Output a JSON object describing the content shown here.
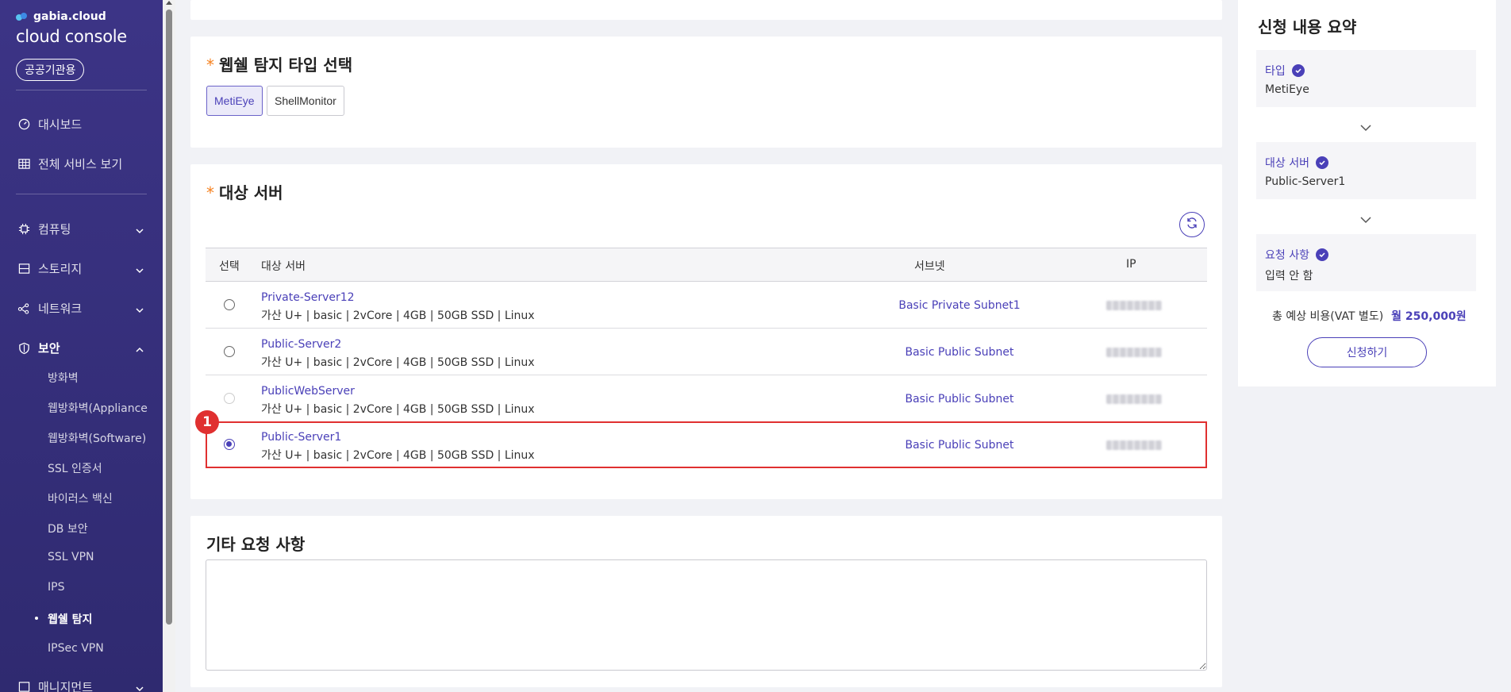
{
  "sidebar": {
    "brand": "gabia.cloud",
    "title": "cloud console",
    "badge": "공공기관용",
    "top_items": [
      {
        "label": "대시보드",
        "icon": "dashboard-icon"
      },
      {
        "label": "전체 서비스 보기",
        "icon": "grid-icon"
      }
    ],
    "menus": [
      {
        "label": "컴퓨팅",
        "icon": "cpu-icon"
      },
      {
        "label": "스토리지",
        "icon": "storage-icon"
      },
      {
        "label": "네트워크",
        "icon": "network-icon"
      },
      {
        "label": "보안",
        "icon": "shield-icon"
      }
    ],
    "security_sub": [
      "방화벽",
      "웹방화벽(Appliance",
      "웹방화벽(Software)",
      "SSL 인증서",
      "바이러스 백신",
      "DB 보안",
      "SSL VPN",
      "IPS",
      "웹쉘 탐지",
      "IPSec VPN"
    ],
    "last_menu": "매니지먼트"
  },
  "type_section": {
    "title": "웹쉘 탐지 타입 선택",
    "required_mark": "*",
    "options": [
      "MetiEye",
      "ShellMonitor"
    ],
    "selected": "MetiEye"
  },
  "server_section": {
    "title": "대상 서버",
    "required_mark": "*",
    "columns": {
      "select": "선택",
      "server": "대상 서버",
      "subnet": "서브넷",
      "ip": "IP"
    },
    "rows": [
      {
        "name": "Private-Server12",
        "spec": "가산 U+ | basic | 2vCore | 4GB | 50GB SSD | Linux",
        "subnet": "Basic Private Subnet1",
        "state": "unchecked"
      },
      {
        "name": "Public-Server2",
        "spec": "가산 U+ | basic | 2vCore | 4GB | 50GB SSD | Linux",
        "subnet": "Basic Public Subnet",
        "state": "unchecked"
      },
      {
        "name": "PublicWebServer",
        "spec": "가산 U+ | basic | 2vCore | 4GB | 50GB SSD | Linux",
        "subnet": "Basic Public Subnet",
        "state": "disabled"
      },
      {
        "name": "Public-Server1",
        "spec": "가산 U+ | basic | 2vCore | 4GB | 50GB SSD | Linux",
        "subnet": "Basic Public Subnet",
        "state": "checked"
      }
    ],
    "step_marker": "1"
  },
  "request_section": {
    "title": "기타 요청 사항",
    "value": ""
  },
  "summary": {
    "title": "신청 내용 요약",
    "items": [
      {
        "label": "타입",
        "value": "MetiEye"
      },
      {
        "label": "대상 서버",
        "value": "Public-Server1"
      },
      {
        "label": "요청 사항",
        "value": "입력 안 함"
      }
    ],
    "cost_label": "총 예상 비용(VAT 별도)",
    "cost_value": "월 250,000원",
    "apply_label": "신청하기"
  },
  "colors": {
    "brand": "#4a40b8",
    "sidebar": "#3c3486",
    "required": "#f58220",
    "highlight": "#e03030"
  }
}
